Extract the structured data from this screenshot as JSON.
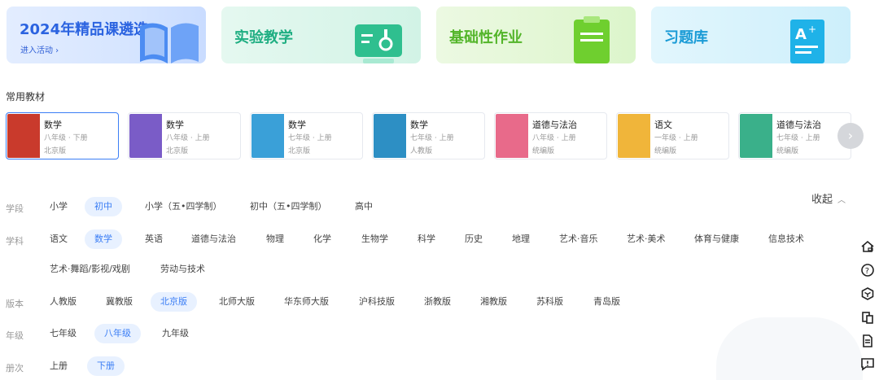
{
  "banners": [
    {
      "title": "2024年精品课遴选",
      "sub": "进入活动 ›"
    },
    {
      "title": "实验教学"
    },
    {
      "title": "基础性作业"
    },
    {
      "title": "习题库"
    }
  ],
  "section_title": "常用教材",
  "books": [
    {
      "subject": "数学",
      "grade": "八年级 · 下册",
      "version": "北京版",
      "cover_color": "#c93a2c"
    },
    {
      "subject": "数学",
      "grade": "八年级 · 上册",
      "version": "北京版",
      "cover_color": "#7a5cc7"
    },
    {
      "subject": "数学",
      "grade": "七年级 · 上册",
      "version": "北京版",
      "cover_color": "#3aa0d8"
    },
    {
      "subject": "数学",
      "grade": "七年级 · 上册",
      "version": "人教版",
      "cover_color": "#2d8fc4"
    },
    {
      "subject": "道德与法治",
      "grade": "八年级 · 上册",
      "version": "统编版",
      "cover_color": "#e86a8a"
    },
    {
      "subject": "语文",
      "grade": "一年级 · 上册",
      "version": "统编版",
      "cover_color": "#f0b53a"
    },
    {
      "subject": "道德与法治",
      "grade": "七年级 · 上册",
      "version": "统编版",
      "cover_color": "#3ab08a"
    }
  ],
  "collapse_label": "收起",
  "filters": {
    "stage": {
      "label": "学段",
      "options": [
        "小学",
        "初中",
        "小学（五•四学制）",
        "初中（五•四学制）",
        "高中"
      ]
    },
    "subject": {
      "label": "学科",
      "options": [
        "语文",
        "数学",
        "英语",
        "道德与法治",
        "物理",
        "化学",
        "生物学",
        "科学",
        "历史",
        "地理",
        "艺术·音乐",
        "艺术·美术",
        "体育与健康",
        "信息技术",
        "艺术·舞蹈/影视/戏剧",
        "劳动与技术"
      ]
    },
    "edition": {
      "label": "版本",
      "options": [
        "人教版",
        "冀教版",
        "北京版",
        "北师大版",
        "华东师大版",
        "沪科技版",
        "浙教版",
        "湘教版",
        "苏科版",
        "青岛版"
      ]
    },
    "grade": {
      "label": "年级",
      "options": [
        "七年级",
        "八年级",
        "九年级"
      ]
    },
    "volume": {
      "label": "册次",
      "options": [
        "上册",
        "下册"
      ]
    }
  },
  "colors": {
    "accent": "#3b7ef5",
    "accent_bg": "#e8f1ff"
  },
  "tools": [
    "home-icon",
    "help-icon",
    "cube-icon",
    "copy-icon",
    "document-icon",
    "feedback-icon"
  ]
}
